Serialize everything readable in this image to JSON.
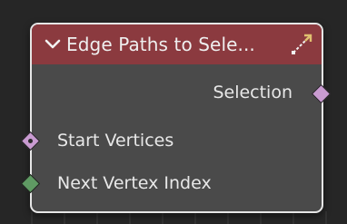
{
  "node": {
    "title": "Edge Paths to Sele...",
    "header_color": "#8b3a3f",
    "body_color": "#4a4a4a",
    "outline_color": "#e6e6e6",
    "collapse_icon": "chevron-down-icon",
    "tool_icon": "edge-path-select-icon"
  },
  "outputs": [
    {
      "label": "Selection",
      "socket_color": "#c99bd1",
      "socket_shape": "diamond"
    }
  ],
  "inputs": [
    {
      "label": "Start Vertices",
      "socket_color": "#c99bd1",
      "socket_shape": "diamond-dot"
    },
    {
      "label": "Next Vertex Index",
      "socket_color": "#5f9a63",
      "socket_shape": "diamond"
    }
  ]
}
